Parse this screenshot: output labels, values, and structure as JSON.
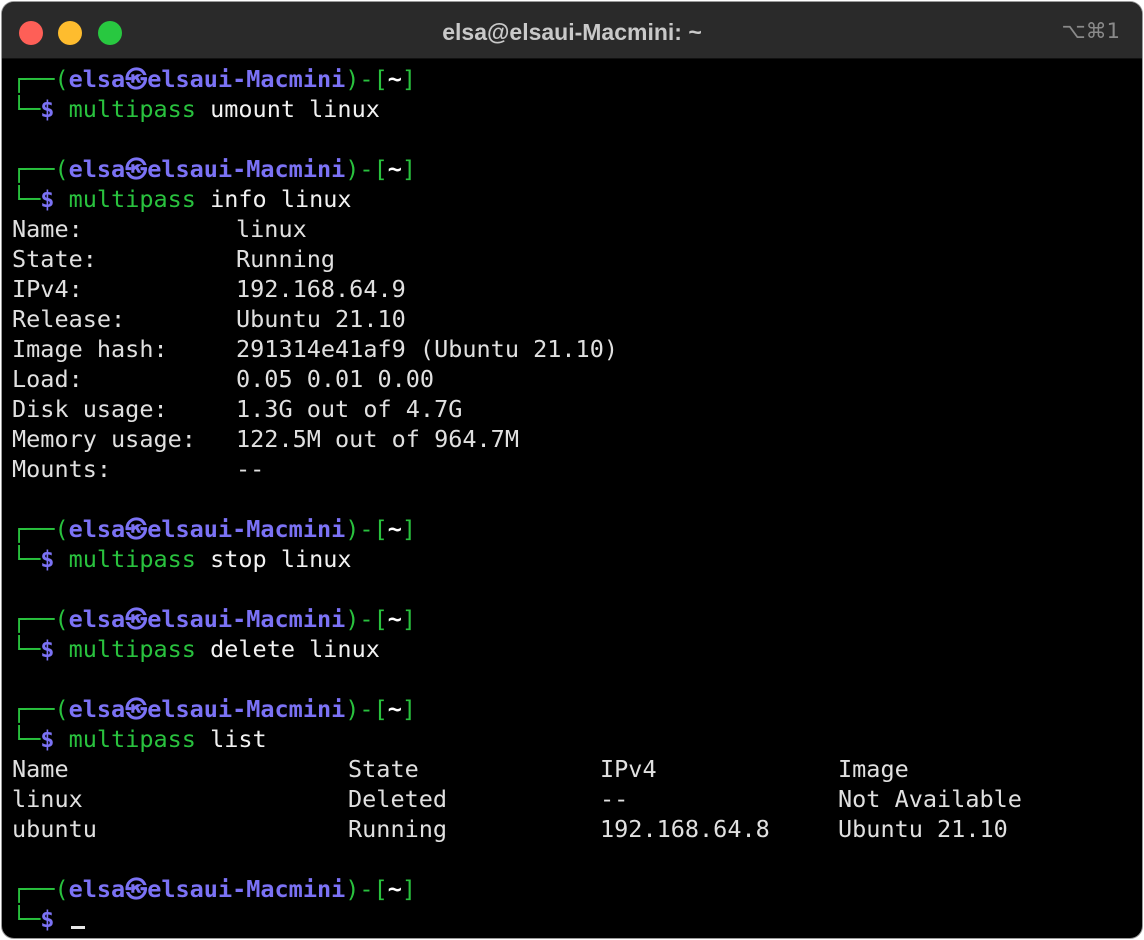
{
  "window": {
    "title": "elsa@elsaui-Macmini: ~",
    "shortcut": "⌥⌘1"
  },
  "prompt": {
    "user": "elsa",
    "separator": "㉿",
    "host": "elsaui-Macmini",
    "dir": "~",
    "symbol": "$"
  },
  "commands": {
    "c1": {
      "cmd": "multipass",
      "args": " umount linux"
    },
    "c2": {
      "cmd": "multipass",
      "args": " info linux"
    },
    "c3": {
      "cmd": "multipass",
      "args": " stop linux"
    },
    "c4": {
      "cmd": "multipass",
      "args": " delete linux"
    },
    "c5": {
      "cmd": "multipass",
      "args": " list"
    }
  },
  "info": [
    {
      "key": "Name:",
      "value": "linux"
    },
    {
      "key": "State:",
      "value": "Running"
    },
    {
      "key": "IPv4:",
      "value": "192.168.64.9"
    },
    {
      "key": "Release:",
      "value": "Ubuntu 21.10"
    },
    {
      "key": "Image hash:",
      "value": "291314e41af9 (Ubuntu 21.10)"
    },
    {
      "key": "Load:",
      "value": "0.05 0.01 0.00"
    },
    {
      "key": "Disk usage:",
      "value": "1.3G out of 4.7G"
    },
    {
      "key": "Memory usage:",
      "value": "122.5M out of 964.7M"
    },
    {
      "key": "Mounts:",
      "value": "--"
    }
  ],
  "list_table": {
    "headers": [
      "Name",
      "State",
      "IPv4",
      "Image"
    ],
    "rows": [
      [
        "linux",
        "Deleted",
        "--",
        "Not Available"
      ],
      [
        "ubuntu",
        "Running",
        "192.168.64.8",
        "Ubuntu 21.10"
      ]
    ]
  },
  "colors": {
    "prompt_green": "#29c23e",
    "prompt_blue": "#7b72f5",
    "background": "#000000"
  }
}
